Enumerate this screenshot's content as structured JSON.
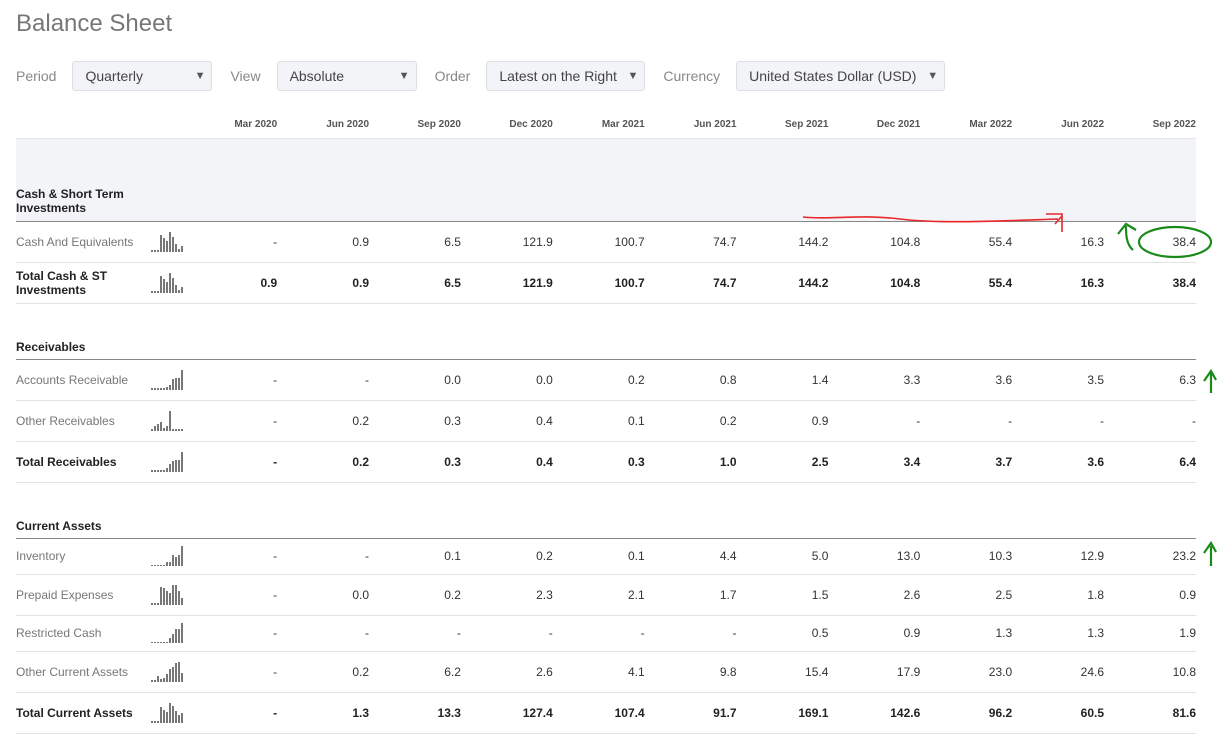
{
  "page": {
    "title": "Balance Sheet"
  },
  "controls": [
    {
      "id": "period",
      "label": "Period",
      "value": "Quarterly"
    },
    {
      "id": "view",
      "label": "View",
      "value": "Absolute"
    },
    {
      "id": "order",
      "label": "Order",
      "value": "Latest on the Right"
    },
    {
      "id": "currency",
      "label": "Currency",
      "value": "United States Dollar (USD)"
    }
  ],
  "periods": [
    "Mar 2020",
    "Jun 2020",
    "Sep 2020",
    "Dec 2020",
    "Mar 2021",
    "Jun 2021",
    "Sep 2021",
    "Dec 2021",
    "Mar 2022",
    "Jun 2022",
    "Sep 2022"
  ],
  "sections": [
    {
      "title": "Cash & Short Term Investments",
      "rows": [
        {
          "label": "Cash And Equivalents",
          "total": false,
          "values": [
            "-",
            "0.9",
            "6.5",
            "121.9",
            "100.7",
            "74.7",
            "144.2",
            "104.8",
            "55.4",
            "16.3",
            "38.4"
          ]
        },
        {
          "label": "Total Cash & ST Investments",
          "total": true,
          "values": [
            "0.9",
            "0.9",
            "6.5",
            "121.9",
            "100.7",
            "74.7",
            "144.2",
            "104.8",
            "55.4",
            "16.3",
            "38.4"
          ]
        }
      ]
    },
    {
      "title": "Receivables",
      "rows": [
        {
          "label": "Accounts Receivable",
          "total": false,
          "values": [
            "-",
            "-",
            "0.0",
            "0.0",
            "0.2",
            "0.8",
            "1.4",
            "3.3",
            "3.6",
            "3.5",
            "6.3"
          ]
        },
        {
          "label": "Other Receivables",
          "total": false,
          "values": [
            "-",
            "0.2",
            "0.3",
            "0.4",
            "0.1",
            "0.2",
            "0.9",
            "-",
            "-",
            "-",
            "-"
          ]
        },
        {
          "label": "Total Receivables",
          "total": true,
          "values": [
            "-",
            "0.2",
            "0.3",
            "0.4",
            "0.3",
            "1.0",
            "2.5",
            "3.4",
            "3.7",
            "3.6",
            "6.4"
          ]
        }
      ]
    },
    {
      "title": "Current Assets",
      "rows": [
        {
          "label": "Inventory",
          "total": false,
          "values": [
            "-",
            "-",
            "0.1",
            "0.2",
            "0.1",
            "4.4",
            "5.0",
            "13.0",
            "10.3",
            "12.9",
            "23.2"
          ]
        },
        {
          "label": "Prepaid Expenses",
          "total": false,
          "values": [
            "-",
            "0.0",
            "0.2",
            "2.3",
            "2.1",
            "1.7",
            "1.5",
            "2.6",
            "2.5",
            "1.8",
            "0.9"
          ]
        },
        {
          "label": "Restricted Cash",
          "total": false,
          "values": [
            "-",
            "-",
            "-",
            "-",
            "-",
            "-",
            "0.5",
            "0.9",
            "1.3",
            "1.3",
            "1.9"
          ]
        },
        {
          "label": "Other Current Assets",
          "total": false,
          "values": [
            "-",
            "0.2",
            "6.2",
            "2.6",
            "4.1",
            "9.8",
            "15.4",
            "17.9",
            "23.0",
            "24.6",
            "10.8"
          ]
        },
        {
          "label": "Total Current Assets",
          "total": true,
          "values": [
            "-",
            "1.3",
            "13.3",
            "127.4",
            "107.4",
            "91.7",
            "169.1",
            "142.6",
            "96.2",
            "60.5",
            "81.6"
          ]
        }
      ]
    }
  ],
  "annotation_colors": {
    "red": "#e8262b",
    "green": "#1a8a1a"
  }
}
